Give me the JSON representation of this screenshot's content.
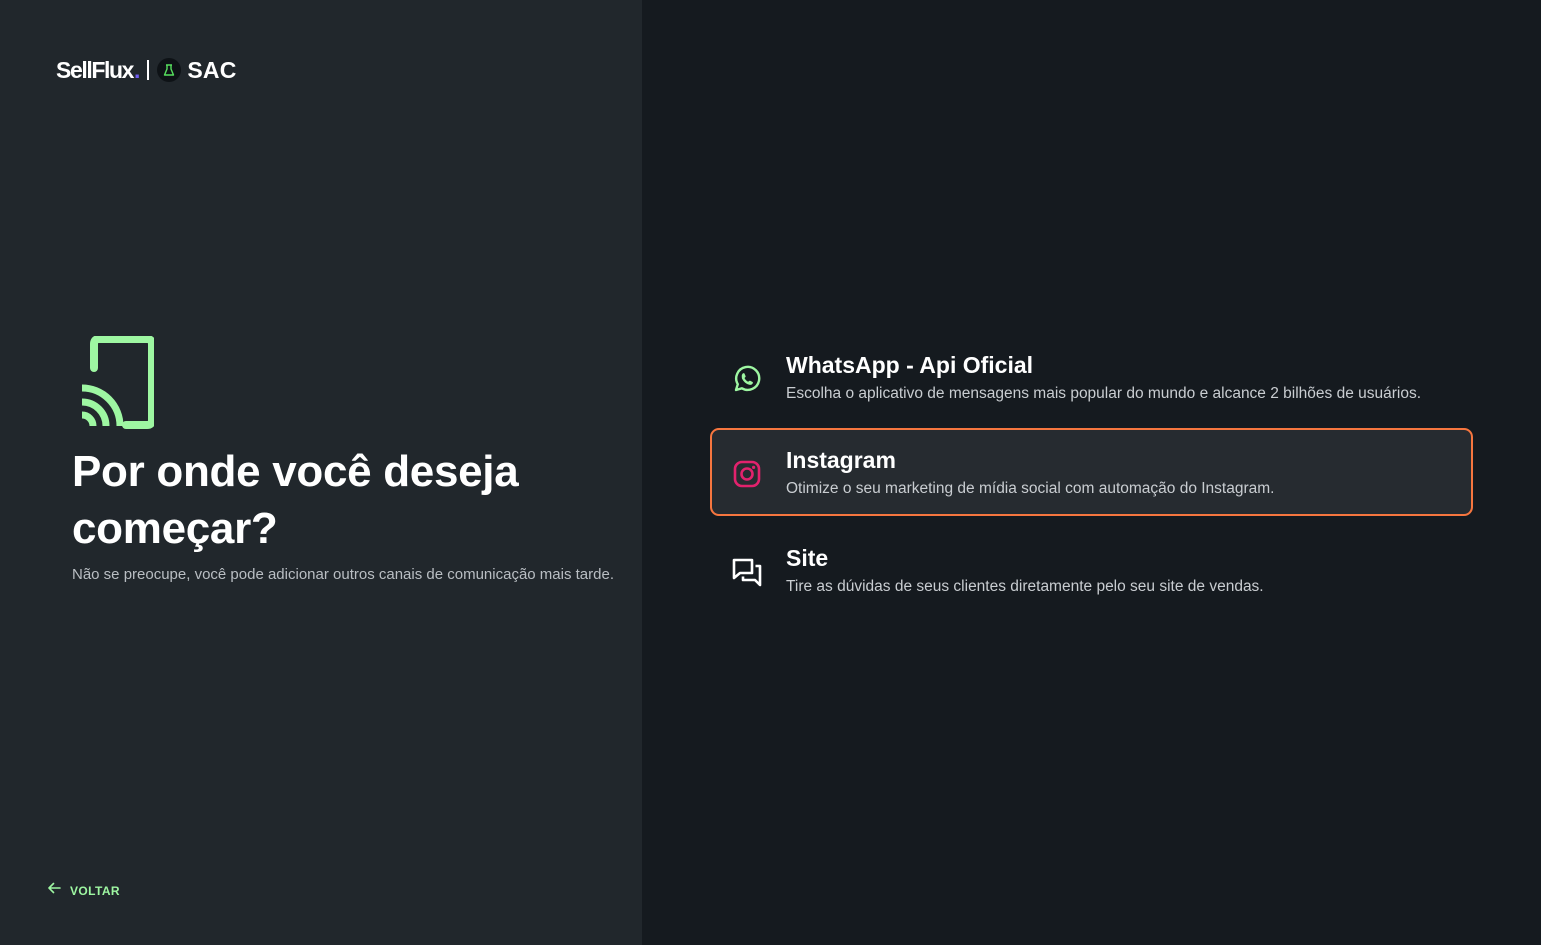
{
  "brand": {
    "name": "SellFlux",
    "dot": ".",
    "product": "SAC",
    "accent_color": "#9ef7a2",
    "dot_color": "#6f5cf0"
  },
  "hero": {
    "icon": "cast-connected-icon",
    "headline": "Por onde você deseja começar?",
    "subtext": "Não se preocupe, você pode adicionar outros canais de comunicação mais tarde."
  },
  "back": {
    "icon": "arrow-left-icon",
    "label": "VOLTAR"
  },
  "options": [
    {
      "icon": "whatsapp-icon",
      "title": "WhatsApp - Api Oficial",
      "description": "Escolha o aplicativo de mensagens mais popular do mundo e alcance 2 bilhões de usuários.",
      "selected": false,
      "icon_color": "#9ef7a2"
    },
    {
      "icon": "instagram-icon",
      "title": "Instagram",
      "description": "Otimize o seu marketing de mídia social com automação do Instagram.",
      "selected": true,
      "icon_color": "#e2226d",
      "border_color": "#f6763f"
    },
    {
      "icon": "chat-bubbles-icon",
      "title": "Site",
      "description": "Tire as dúvidas de seus clientes diretamente pelo seu site de vendas.",
      "selected": false,
      "icon_color": "#ffffff"
    }
  ]
}
